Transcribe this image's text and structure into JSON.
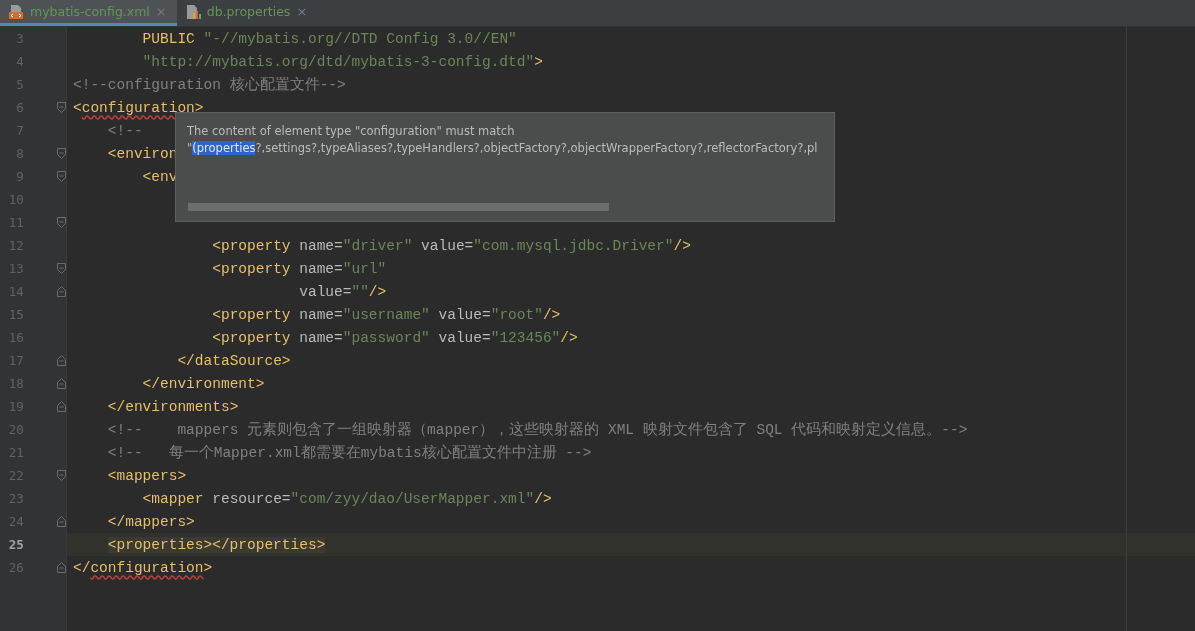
{
  "tabs": [
    {
      "label": "mybatis-config.xml",
      "kind": "xml",
      "selected": true,
      "close": "×"
    },
    {
      "label": "db.properties",
      "kind": "properties",
      "selected": false,
      "close": "×"
    }
  ],
  "editor": {
    "lines": [
      {
        "number": "3",
        "kind": "plain",
        "tokens": [
          {
            "kind": "tag",
            "text": "        PUBLIC"
          },
          {
            "kind": "value",
            "text": " \"-//mybatis.org//DTD Config 3.0//EN\""
          }
        ]
      },
      {
        "number": "4",
        "kind": "plain",
        "tokens": [
          {
            "kind": "value",
            "text": "        \"http://mybatis.org/dtd/mybatis-3-config.dtd\""
          },
          {
            "kind": "tag",
            "text": ">"
          }
        ]
      },
      {
        "number": "5",
        "kind": "plain",
        "tokens": [
          {
            "kind": "comment",
            "text": "<!--configuration 核心配置文件-->"
          }
        ]
      },
      {
        "number": "6",
        "kind": "fold-start",
        "tokens": [
          {
            "kind": "tag",
            "text": "<"
          },
          {
            "kind": "tag",
            "text": "configuration",
            "error": true
          },
          {
            "kind": "tag",
            "text": ">"
          }
        ]
      },
      {
        "number": "7",
        "kind": "plain",
        "tokens": [
          {
            "kind": "comment",
            "text": "    <!--"
          }
        ]
      },
      {
        "number": "8",
        "kind": "fold-start",
        "tokens": [
          {
            "kind": "tag",
            "text": "    <environ"
          }
        ]
      },
      {
        "number": "9",
        "kind": "fold-start",
        "tokens": [
          {
            "kind": "tag",
            "text": "        <env"
          }
        ]
      },
      {
        "number": "10",
        "kind": "plain"
      },
      {
        "number": "11",
        "kind": "fold-start"
      },
      {
        "number": "12",
        "kind": "plain",
        "tokens": [
          {
            "kind": "tag",
            "text": "                <property"
          },
          {
            "kind": "attr",
            "text": " name="
          },
          {
            "kind": "value",
            "text": "\"driver\""
          },
          {
            "kind": "attr",
            "text": " value="
          },
          {
            "kind": "value",
            "text": "\"com.mysql.jdbc.Driver\""
          },
          {
            "kind": "tag",
            "text": "/>"
          }
        ]
      },
      {
        "number": "13",
        "kind": "fold-start",
        "tokens": [
          {
            "kind": "tag",
            "text": "                <property"
          },
          {
            "kind": "attr",
            "text": " name="
          },
          {
            "kind": "value",
            "text": "\"url\""
          }
        ]
      },
      {
        "number": "14",
        "kind": "fold-end",
        "tokens": [
          {
            "kind": "attr",
            "text": "                          value="
          },
          {
            "kind": "value",
            "text": "\"\""
          },
          {
            "kind": "tag",
            "text": "/>"
          }
        ]
      },
      {
        "number": "15",
        "kind": "plain",
        "tokens": [
          {
            "kind": "tag",
            "text": "                <property"
          },
          {
            "kind": "attr",
            "text": " name="
          },
          {
            "kind": "value",
            "text": "\"username\""
          },
          {
            "kind": "attr",
            "text": " value="
          },
          {
            "kind": "value",
            "text": "\"root\""
          },
          {
            "kind": "tag",
            "text": "/>"
          }
        ]
      },
      {
        "number": "16",
        "kind": "plain",
        "tokens": [
          {
            "kind": "tag",
            "text": "                <property"
          },
          {
            "kind": "attr",
            "text": " name="
          },
          {
            "kind": "value",
            "text": "\"password\""
          },
          {
            "kind": "attr",
            "text": " value="
          },
          {
            "kind": "value",
            "text": "\"123456\""
          },
          {
            "kind": "tag",
            "text": "/>"
          }
        ]
      },
      {
        "number": "17",
        "kind": "fold-end",
        "tokens": [
          {
            "kind": "tag",
            "text": "            </dataSource>"
          }
        ]
      },
      {
        "number": "18",
        "kind": "fold-end",
        "tokens": [
          {
            "kind": "tag",
            "text": "        </environment>"
          }
        ]
      },
      {
        "number": "19",
        "kind": "fold-end",
        "tokens": [
          {
            "kind": "tag",
            "text": "    </environments>"
          }
        ]
      },
      {
        "number": "20",
        "kind": "plain",
        "tokens": [
          {
            "kind": "comment",
            "text": "    <!--    mappers 元素则包含了一组映射器（mapper），这些映射器的 XML 映射文件包含了 SQL 代码和映射定义信息。-->"
          }
        ]
      },
      {
        "number": "21",
        "kind": "plain",
        "tokens": [
          {
            "kind": "comment",
            "text": "    <!--   每一个Mapper.xml都需要在mybatis核心配置文件中注册 -->"
          }
        ]
      },
      {
        "number": "22",
        "kind": "fold-start",
        "tokens": [
          {
            "kind": "tag",
            "text": "    <mappers>"
          }
        ]
      },
      {
        "number": "23",
        "kind": "plain",
        "tokens": [
          {
            "kind": "tag",
            "text": "        <mapper"
          },
          {
            "kind": "attr",
            "text": " resource="
          },
          {
            "kind": "value",
            "text": "\"com/zyy/dao/UserMapper.xml\""
          },
          {
            "kind": "tag",
            "text": "/>"
          }
        ]
      },
      {
        "number": "24",
        "kind": "fold-end",
        "tokens": [
          {
            "kind": "tag",
            "text": "    </mappers>"
          }
        ]
      },
      {
        "number": "25",
        "kind": "plain",
        "current": true,
        "tokens": [
          {
            "kind": "match",
            "text": "<properties></properties>"
          }
        ]
      },
      {
        "number": "26",
        "kind": "fold-end",
        "tokens": [
          {
            "kind": "tag",
            "text": "</"
          },
          {
            "kind": "tag",
            "text": "configuration",
            "error": true
          },
          {
            "kind": "tag",
            "text": ">"
          }
        ]
      }
    ]
  },
  "tooltip": {
    "title": "The content of element type \"configuration\" must match",
    "detail": [
      {
        "text": "\"",
        "selected": false
      },
      {
        "text": "(properties",
        "selected": true
      },
      {
        "text": "?,settings?,typeAliases?,typeHandlers?,objectFactory?,objectWrapperFactory?,reflectorFactory?,pl",
        "selected": false
      }
    ]
  }
}
